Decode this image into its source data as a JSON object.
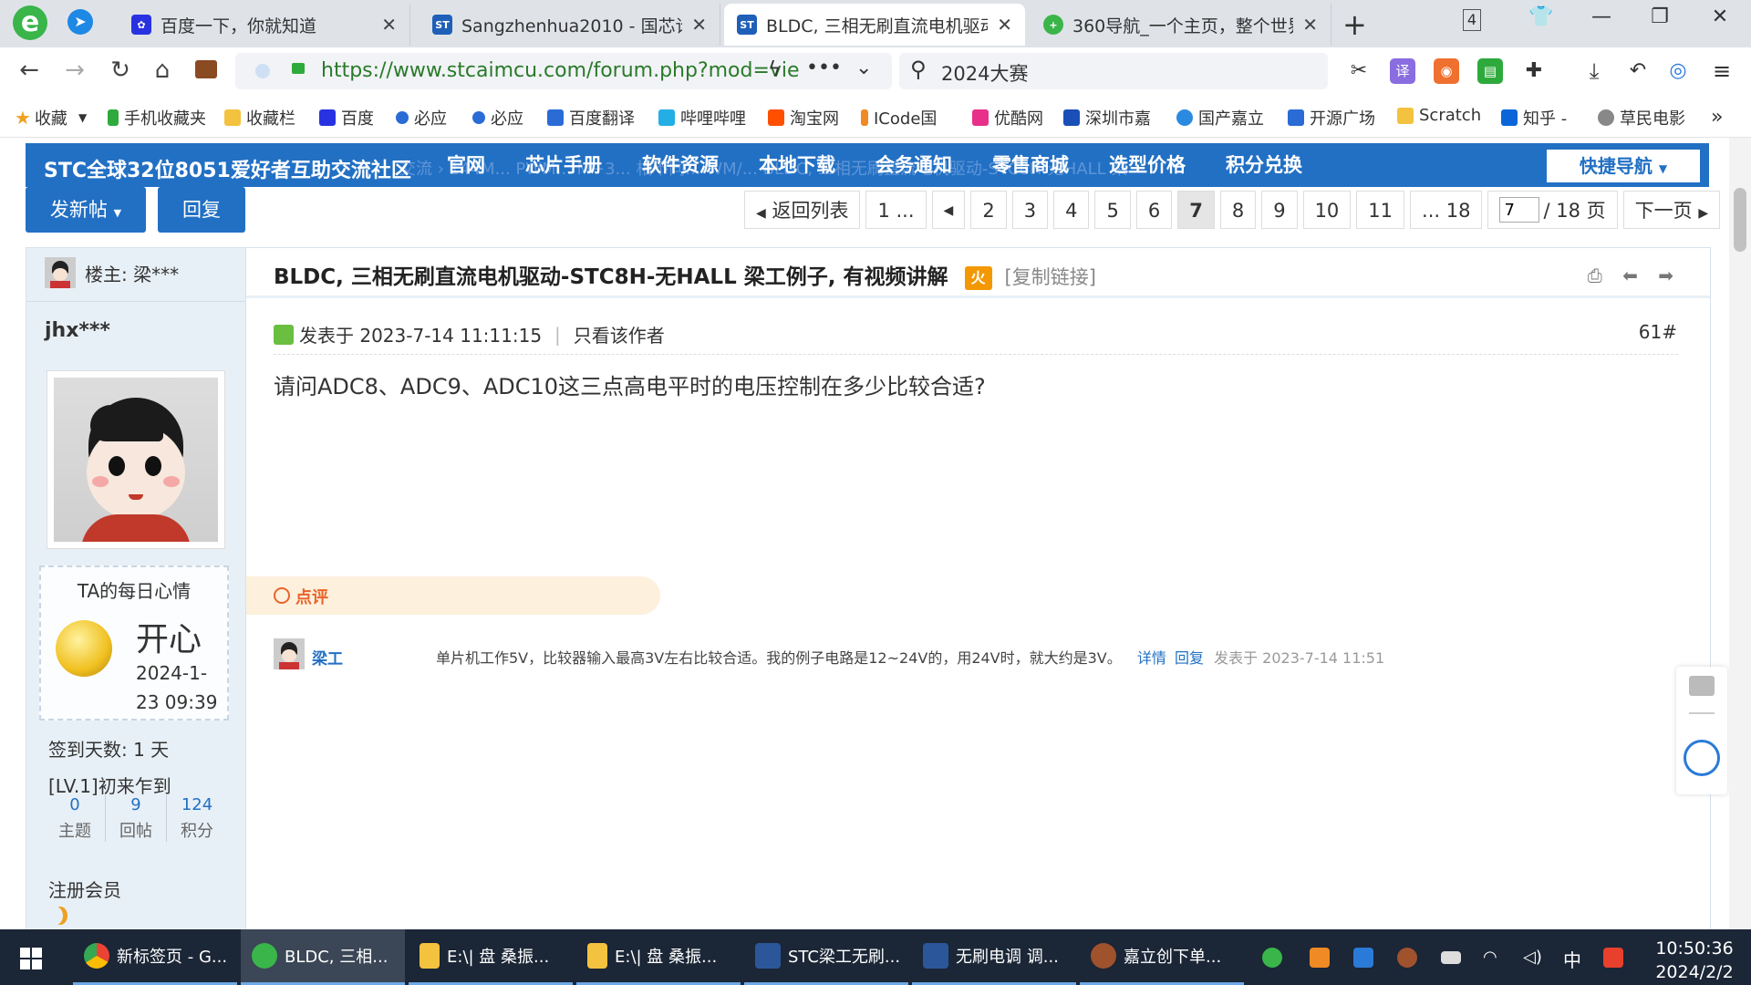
{
  "browser": {
    "tabs": [
      {
        "title": "百度一下，你就知道",
        "favicon_color": "#2932e1"
      },
      {
        "title": "Sangzhenhua2010 - 国芯论坛",
        "favicon_color": "#1f5fb8"
      },
      {
        "title": "BLDC, 三相无刷直流电机驱动",
        "favicon_color": "#1f5fb8",
        "active": true
      },
      {
        "title": "360导航_一个主页，整个世界",
        "favicon_color": "#3bb54a"
      }
    ],
    "tab_close": "✕",
    "new_tab": "+",
    "tab_count": "4",
    "url": "https://www.stcaimcu.com/forum.php?mod=vie",
    "search_text": "2024大赛",
    "bookmarks": [
      "收藏",
      "手机收藏夹",
      "收藏栏",
      "百度",
      "必应",
      "必应",
      "百度翻译",
      "哔哩哔哩",
      "淘宝网",
      "ICode国",
      "优酷网",
      "深圳市嘉",
      "国产嘉立",
      "开源广场",
      "Scratch",
      "知乎 -",
      "草民电影"
    ]
  },
  "site": {
    "brand": "STC全球32位8051爱好者互助交流社区",
    "nav": [
      "官网",
      "芯片手册",
      "软件资源",
      "本地下载",
      "会务通知",
      "零售商城",
      "选型价格",
      "积分兑换"
    ],
    "ghost_breadcrumb": "交流 › 144M... PWM... M+3... 相不同... WM/... BLDC, 三相无刷直流电机驱动-STC8H-无HALL 梁",
    "quick_nav": "快捷导航"
  },
  "actions": {
    "new_post": "发新帖",
    "reply": "回复"
  },
  "pager": {
    "back": "返回列表",
    "first": "1 ...",
    "pages": [
      "2",
      "3",
      "4",
      "5",
      "6",
      "7",
      "8",
      "9",
      "10",
      "11"
    ],
    "current": "7",
    "last": "... 18",
    "input_value": "7",
    "total": "/ 18 页",
    "next": "下一页"
  },
  "sidebar": {
    "op_label": "楼主: 梁***",
    "username": "jhx***",
    "mood_title": "TA的每日心情",
    "mood": "开心",
    "mood_date": "2024-1-23 09:39",
    "signin": "签到天数: 1 天",
    "level": "[LV.1]初来乍到",
    "stats": [
      {
        "value": "0",
        "label": "主题"
      },
      {
        "value": "9",
        "label": "回帖"
      },
      {
        "value": "124",
        "label": "积分"
      }
    ],
    "member_type": "注册会员"
  },
  "post": {
    "title": "BLDC, 三相无刷直流电机驱动-STC8H-无HALL 梁工例子, 有视频讲解",
    "hot": "火",
    "copy_link": "[复制链接]",
    "posted_at": "发表于 2023-7-14 11:11:15",
    "only_author": "只看该作者",
    "floor": "61#",
    "body": "请问ADC8、ADC9、ADC10这三点高电平时的电压控制在多少比较合适?",
    "comment_label": "点评",
    "comment": {
      "author": "梁工",
      "text": "单片机工作5V，比较器输入最高3V左右比较合适。我的例子电路是12~24V的，用24V时，就大约是3V。",
      "detail": "详情",
      "reply": "回复",
      "time": "发表于 2023-7-14 11:51"
    }
  },
  "taskbar": {
    "items": [
      "新标签页 - G...",
      "BLDC, 三相...",
      "E:\\| 盘  桑振...",
      "E:\\| 盘  桑振...",
      "STC梁工无刷...",
      "无刷电调  调...",
      "嘉立创下单..."
    ],
    "ime": "中",
    "time": "10:50:36",
    "date": "2024/2/2"
  }
}
